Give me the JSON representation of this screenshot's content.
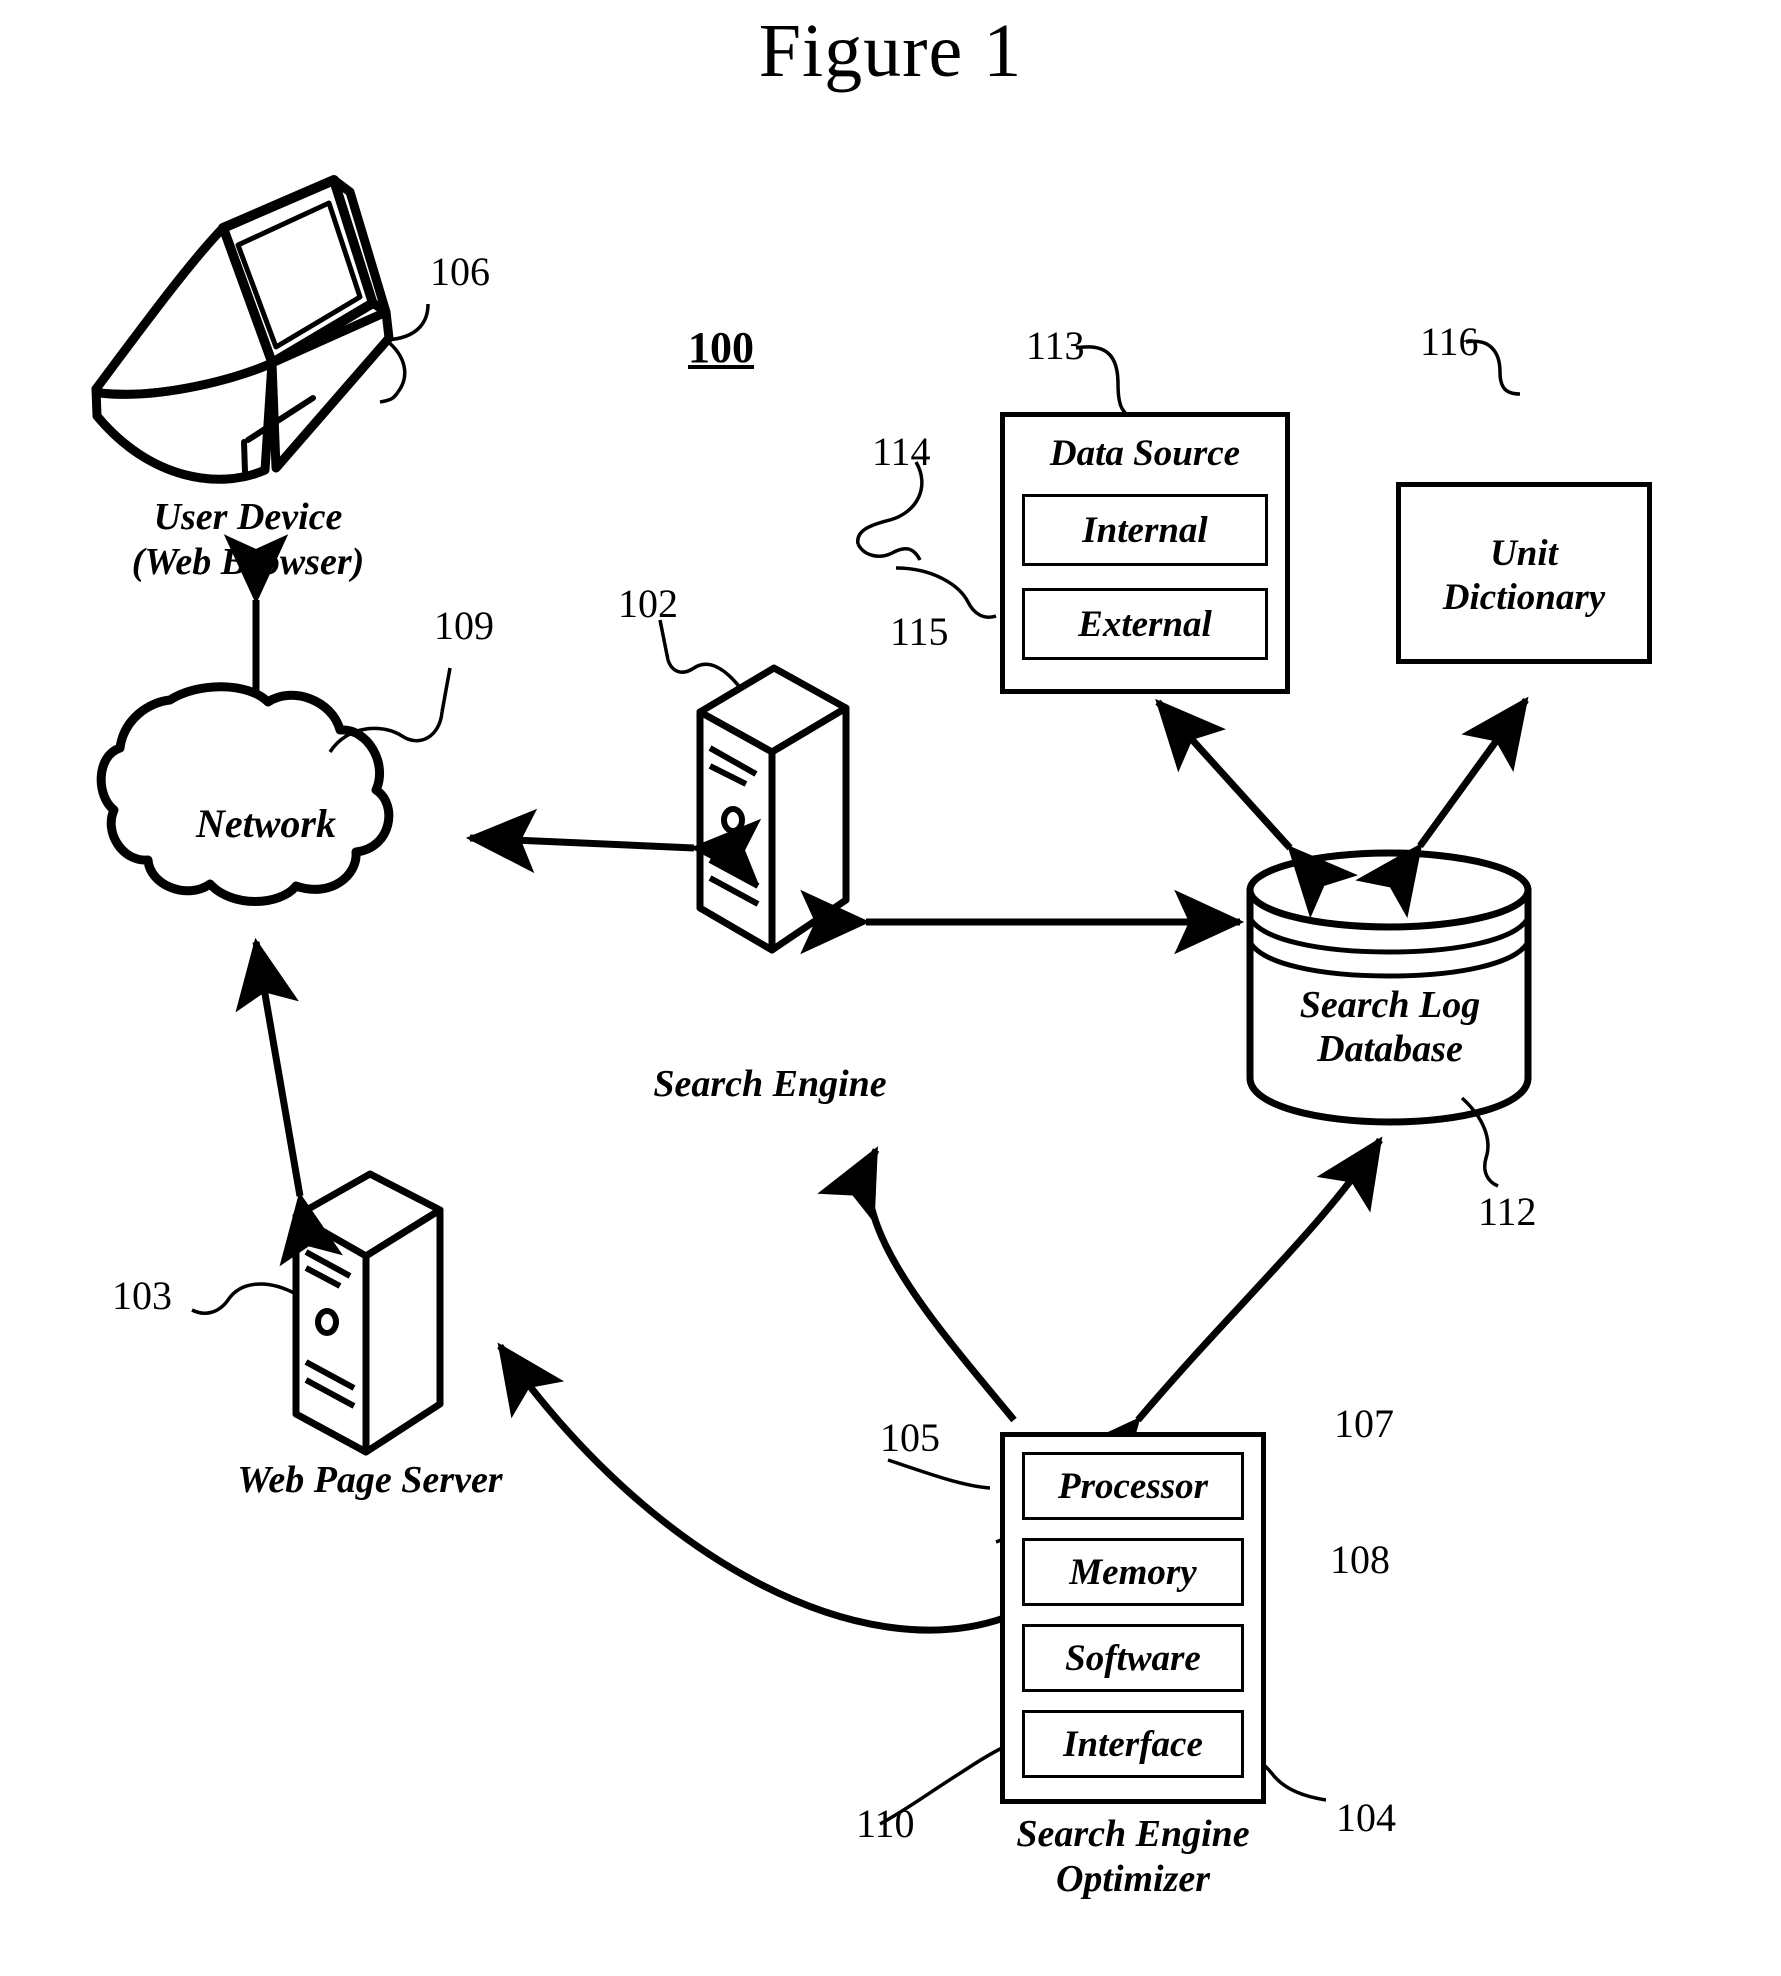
{
  "figure": {
    "title": "Figure 1",
    "system_number": "100"
  },
  "nodes": {
    "user_device": {
      "icon": "laptop-icon",
      "caption_line1": "User Device",
      "caption_line2": "(Web Browser)",
      "ref": "106"
    },
    "network": {
      "icon": "cloud-icon",
      "label": "Network",
      "ref": "109"
    },
    "web_page_server": {
      "icon": "server-tower-icon",
      "label": "Web Page Server",
      "ref": "103"
    },
    "search_engine": {
      "icon": "server-tower-icon",
      "label": "Search Engine",
      "ref": "102"
    },
    "data_source": {
      "label": "Data Source",
      "ref": "113",
      "children": [
        {
          "label": "Internal",
          "ref": "114"
        },
        {
          "label": "External",
          "ref": "115"
        }
      ]
    },
    "unit_dictionary": {
      "label_line1": "Unit",
      "label_line2": "Dictionary",
      "ref": "116"
    },
    "search_log_database": {
      "icon": "cylinder-database-icon",
      "label_line1": "Search Log",
      "label_line2": "Database",
      "ref": "112"
    },
    "search_engine_optimizer": {
      "caption_line1": "Search Engine",
      "caption_line2": "Optimizer",
      "ref": "104",
      "children": [
        {
          "label": "Processor",
          "ref": "105"
        },
        {
          "label": "Memory",
          "ref": "107"
        },
        {
          "label": "Software",
          "ref": "108"
        },
        {
          "label": "Interface",
          "ref": "110"
        }
      ]
    }
  },
  "connections": [
    {
      "from": "user_device",
      "to": "network",
      "style": "double-arrow"
    },
    {
      "from": "web_page_server",
      "to": "network",
      "style": "double-arrow"
    },
    {
      "from": "search_engine",
      "to": "network",
      "style": "double-arrow"
    },
    {
      "from": "search_engine",
      "to": "search_log_database",
      "style": "double-arrow"
    },
    {
      "from": "search_log_database",
      "to": "data_source",
      "style": "double-arrow"
    },
    {
      "from": "search_log_database",
      "to": "unit_dictionary",
      "style": "double-arrow"
    },
    {
      "from": "search_engine_optimizer",
      "to": "search_engine",
      "style": "single-arrow"
    },
    {
      "from": "search_engine_optimizer",
      "to": "search_log_database",
      "style": "double-arrow"
    },
    {
      "from": "search_engine_optimizer",
      "to": "web_page_server",
      "style": "single-arrow"
    }
  ],
  "colors": {
    "line": "#000000",
    "background": "#ffffff"
  }
}
